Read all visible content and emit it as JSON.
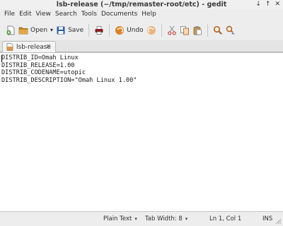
{
  "window": {
    "title": "lsb-release (~/tmp/remaster-root/etc) - gedit",
    "controls": [
      "↓",
      "↑",
      "✕"
    ]
  },
  "menu": {
    "items": [
      "File",
      "Edit",
      "View",
      "Search",
      "Tools",
      "Documents",
      "Help"
    ]
  },
  "toolbar": {
    "new_icon": "new-document-icon",
    "open_label": "Open",
    "open_arrow": "▾",
    "save_label": "Save",
    "print_icon": "printer-icon",
    "undo_label": "Undo",
    "redo_icon": "redo-icon",
    "cut_icon": "scissors-icon",
    "copy_icon": "copy-icon",
    "paste_icon": "paste-icon",
    "find_icon": "magnifier-icon",
    "replace_icon": "find-replace-icon"
  },
  "tabs": [
    {
      "label": "lsb-release",
      "close": "×",
      "icon": "text-file-icon"
    }
  ],
  "editor": {
    "lines": [
      "DISTRIB_ID=Omah Linux",
      "DISTRIB_RELEASE=1.00",
      "DISTRIB_CODENAME=utopic",
      "DISTRIB_DESCRIPTION=\"Omah Linux 1.00\""
    ]
  },
  "status": {
    "language": "Plain Text",
    "tab_width": "Tab Width: 8",
    "position": "Ln 1, Col 1",
    "mode": "INS",
    "dropdown_arrow": "▾"
  },
  "colors": {
    "chrome": "#ededed",
    "editor_bg": "#ffffff",
    "new_icon": "#3f8f2f",
    "open_icon": "#c58a2a",
    "save_icon": "#2f5fa8",
    "undo_icon": "#d9822b",
    "redo_icon": "#e7a25b",
    "find_icon": "#b05a1a"
  }
}
